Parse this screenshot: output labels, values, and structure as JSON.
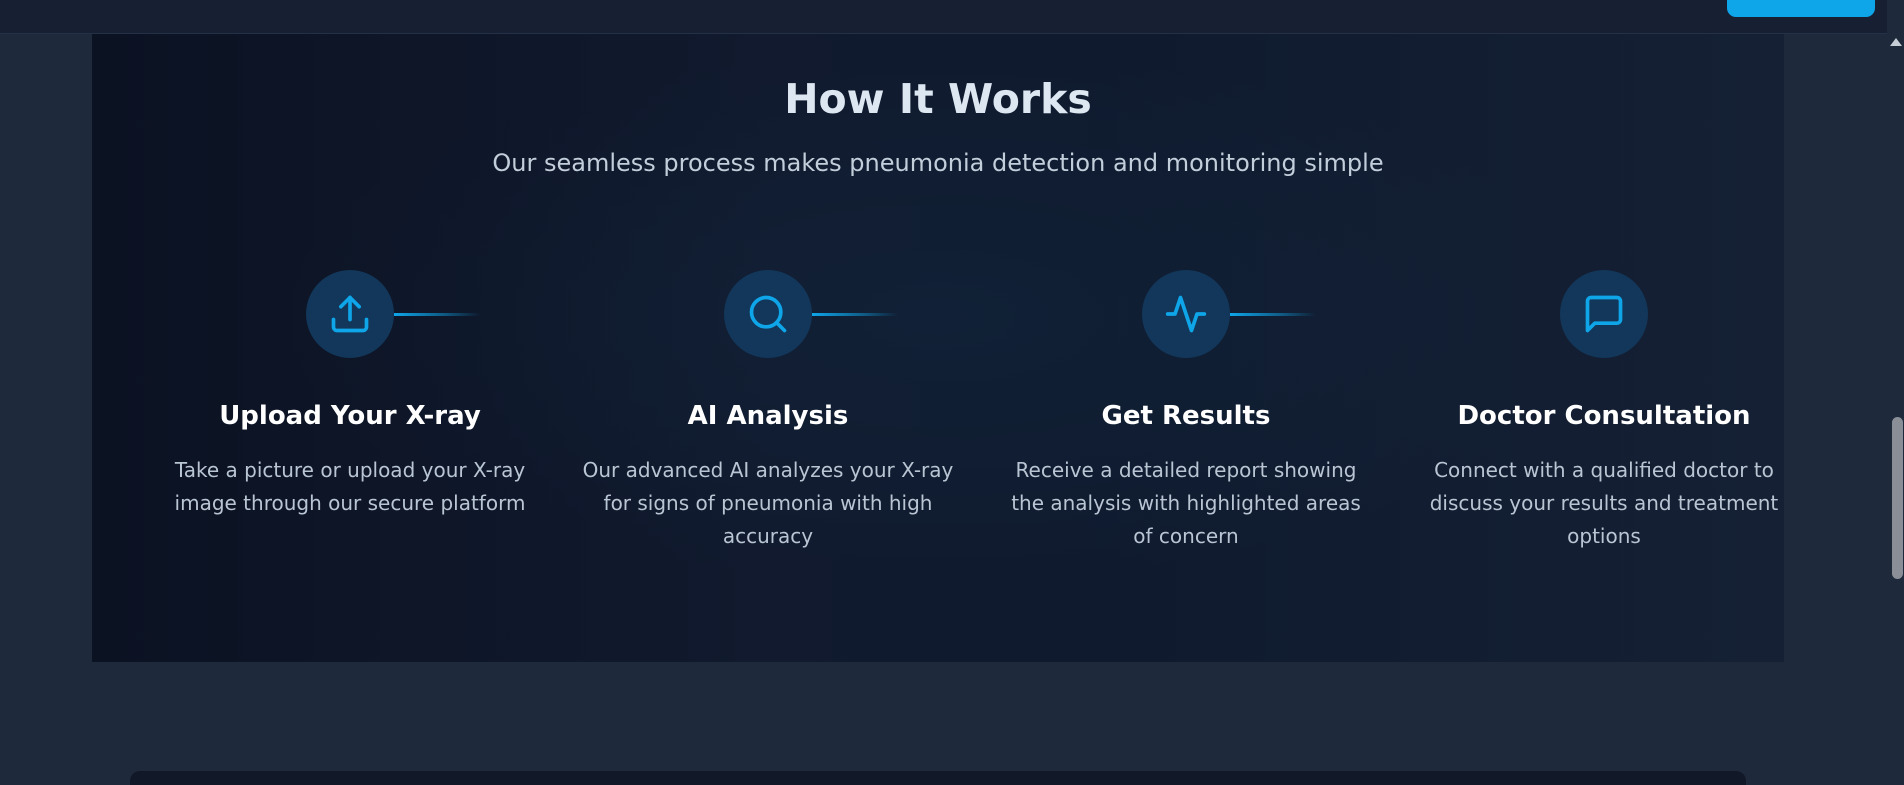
{
  "header": {
    "cta_label": ""
  },
  "how_it_works": {
    "title": "How It Works",
    "subtitle": "Our seamless process makes pneumonia detection and monitoring simple",
    "steps": [
      {
        "icon": "upload-icon",
        "title": "Upload Your X-ray",
        "description": "Take a picture or upload your X-ray image through our secure platform"
      },
      {
        "icon": "search-icon",
        "title": "AI Analysis",
        "description": "Our advanced AI analyzes your X-ray for signs of pneumonia with high accuracy"
      },
      {
        "icon": "activity-icon",
        "title": "Get Results",
        "description": "Receive a detailed report showing the analysis with highlighted areas of concern"
      },
      {
        "icon": "message-square-icon",
        "title": "Doctor Consultation",
        "description": "Connect with a qualified doctor to discuss your results and treatment options"
      }
    ]
  },
  "colors": {
    "accent": "#0ea5e9",
    "icon_circle": "#12375a",
    "page_background": "#1e293b",
    "section_background": "#0f172a"
  }
}
